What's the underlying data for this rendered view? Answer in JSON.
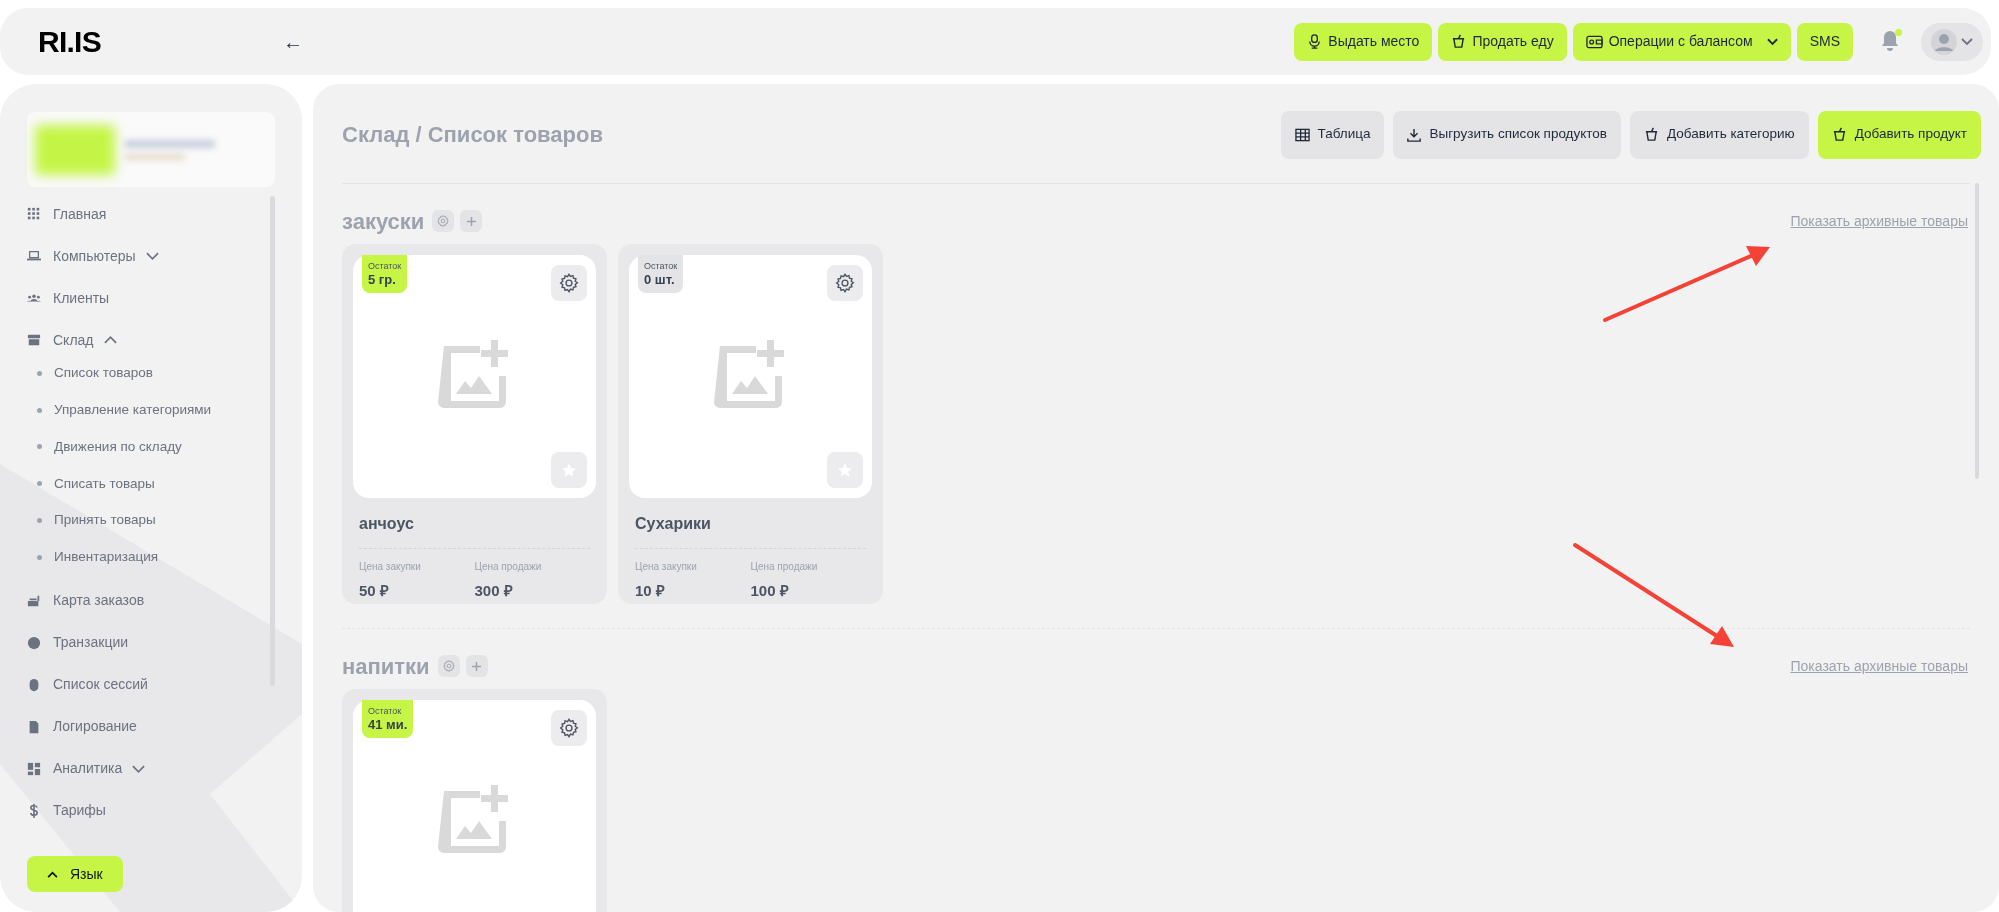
{
  "header": {
    "logo": "RI.IS",
    "back": "←",
    "actions": [
      {
        "label": "Выдать место",
        "dropdown": false
      },
      {
        "label": "Продать еду",
        "dropdown": false
      },
      {
        "label": "Операции с балансом",
        "dropdown": true
      },
      {
        "label": "SMS",
        "dropdown": false
      }
    ],
    "notifications": {
      "unread": true
    }
  },
  "sidebar": {
    "items": [
      {
        "label": "Главная"
      },
      {
        "label": "Компьютеры",
        "expanded": false
      },
      {
        "label": "Клиенты"
      },
      {
        "label": "Склад",
        "expanded": true,
        "children": [
          {
            "label": "Список товаров"
          },
          {
            "label": "Управление категориями"
          },
          {
            "label": "Движения по складу"
          },
          {
            "label": "Списать товары"
          },
          {
            "label": "Принять товары"
          },
          {
            "label": "Инвентаризация"
          }
        ]
      },
      {
        "label": "Карта заказов"
      },
      {
        "label": "Транзакции"
      },
      {
        "label": "Список сессий"
      },
      {
        "label": "Логирование"
      },
      {
        "label": "Аналитика",
        "expanded": false
      },
      {
        "label": "Тарифы"
      }
    ],
    "language_button": "Язык"
  },
  "page": {
    "breadcrumb": "Склад / Список товаров",
    "toolbar": [
      {
        "label": "Таблица",
        "primary": false
      },
      {
        "label": "Выгрузить список продуктов",
        "primary": false
      },
      {
        "label": "Добавить категорию",
        "primary": false
      },
      {
        "label": "Добавить продукт",
        "primary": true
      }
    ],
    "categories": [
      {
        "name": "закуски",
        "archive_link": "Показать архивные товары",
        "products": [
          {
            "stock_label": "Остаток",
            "stock": "5 гр.",
            "in_stock": true,
            "favorite": false,
            "name": "анчоус",
            "buy_label": "Цена закупки",
            "buy_price": "50 ₽",
            "sell_label": "Цена продажи",
            "sell_price": "300 ₽"
          },
          {
            "stock_label": "Остаток",
            "stock": "0 шт.",
            "in_stock": false,
            "favorite": false,
            "name": "Сухарики",
            "buy_label": "Цена закупки",
            "buy_price": "10 ₽",
            "sell_label": "Цена продажи",
            "sell_price": "100 ₽"
          }
        ]
      },
      {
        "name": "напитки",
        "archive_link": "Показать архивные товары",
        "products": [
          {
            "stock_label": "Остаток",
            "stock": "41 ми.",
            "in_stock": true
          }
        ]
      }
    ]
  }
}
